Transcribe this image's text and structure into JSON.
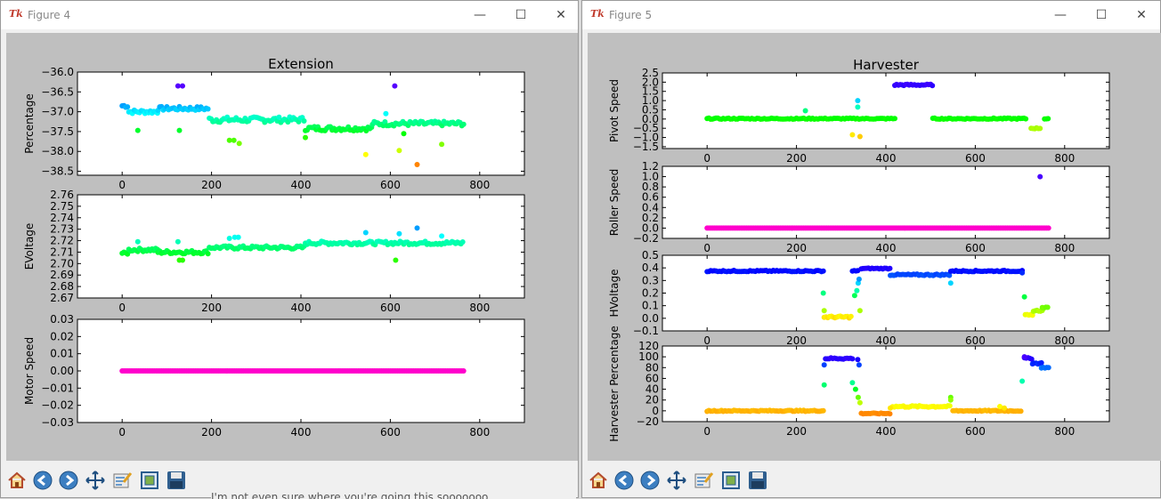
{
  "windows": [
    {
      "title": "Figure 4"
    },
    {
      "title": "Figure 5"
    }
  ],
  "toolbar_icons": [
    "home-icon",
    "back-icon",
    "forward-icon",
    "pan-icon",
    "configure-subplots-icon",
    "edit-icon",
    "save-icon"
  ],
  "background_text": "I'm not even sure where you're going this sooooooo",
  "chart_data": [
    {
      "window": "Figure 4",
      "panel": 0,
      "type": "scatter",
      "title": "Extension",
      "ylabel": "Percentage",
      "xlim": [
        -100,
        900
      ],
      "ylim": [
        -38.6,
        -36.0
      ],
      "xticks": [
        "0",
        "200",
        "400",
        "600",
        "800"
      ],
      "yticks": [
        "−36.0",
        "−36.5",
        "−37.0",
        "−37.5",
        "−38.0",
        "−38.5"
      ],
      "segments": [
        {
          "from": 0,
          "to": 15,
          "y": -36.85,
          "j": 0.05
        },
        {
          "from": 15,
          "to": 80,
          "y": -37.0,
          "j": 0.05
        },
        {
          "from": 80,
          "to": 195,
          "y": -36.92,
          "j": 0.05
        },
        {
          "from": 195,
          "to": 410,
          "y": -37.2,
          "j": 0.07
        },
        {
          "from": 410,
          "to": 560,
          "y": -37.42,
          "j": 0.06
        },
        {
          "from": 560,
          "to": 765,
          "y": -37.3,
          "j": 0.06
        }
      ],
      "outliers": [
        [
          35,
          -37.47
        ],
        [
          125,
          -36.35
        ],
        [
          135,
          -36.35
        ],
        [
          128,
          -37.47
        ],
        [
          240,
          -37.72
        ],
        [
          250,
          -37.72
        ],
        [
          262,
          -37.8
        ],
        [
          410,
          -37.65
        ],
        [
          545,
          -38.08
        ],
        [
          590,
          -37.05
        ],
        [
          610,
          -36.35
        ],
        [
          620,
          -37.98
        ],
        [
          630,
          -37.55
        ],
        [
          660,
          -38.33
        ],
        [
          715,
          -37.82
        ]
      ]
    },
    {
      "window": "Figure 4",
      "panel": 1,
      "type": "scatter",
      "title": "",
      "ylabel": "EVoltage",
      "xlim": [
        -100,
        900
      ],
      "ylim": [
        2.67,
        2.76
      ],
      "xticks": [
        "0",
        "200",
        "400",
        "600",
        "800"
      ],
      "yticks": [
        "2.76",
        "2.75",
        "2.74",
        "2.73",
        "2.72",
        "2.71",
        "2.70",
        "2.69",
        "2.68",
        "2.67"
      ],
      "segments": [
        {
          "from": 0,
          "to": 15,
          "y": 2.709,
          "j": 0.001
        },
        {
          "from": 15,
          "to": 80,
          "y": 2.712,
          "j": 0.0015
        },
        {
          "from": 80,
          "to": 195,
          "y": 2.71,
          "j": 0.0015
        },
        {
          "from": 195,
          "to": 410,
          "y": 2.714,
          "j": 0.0015
        },
        {
          "from": 410,
          "to": 765,
          "y": 2.718,
          "j": 0.0015
        }
      ],
      "outliers": [
        [
          35,
          2.719
        ],
        [
          125,
          2.719
        ],
        [
          128,
          2.703
        ],
        [
          135,
          2.703
        ],
        [
          240,
          2.722
        ],
        [
          252,
          2.723
        ],
        [
          260,
          2.723
        ],
        [
          545,
          2.727
        ],
        [
          612,
          2.703
        ],
        [
          620,
          2.726
        ],
        [
          660,
          2.731
        ],
        [
          715,
          2.724
        ]
      ]
    },
    {
      "window": "Figure 4",
      "panel": 2,
      "type": "scatter",
      "title": "",
      "ylabel": "Motor Speed",
      "xlim": [
        -100,
        900
      ],
      "ylim": [
        -0.03,
        0.03
      ],
      "xticks": [
        "0",
        "200",
        "400",
        "600",
        "800"
      ],
      "yticks": [
        "0.03",
        "0.02",
        "0.01",
        "0.00",
        "−0.01",
        "−0.02",
        "−0.03"
      ],
      "segments": [
        {
          "from": 0,
          "to": 765,
          "y": 0.0,
          "j": 0
        }
      ],
      "outliers": []
    },
    {
      "window": "Figure 5",
      "panel": 0,
      "type": "scatter",
      "title": "Harvester",
      "ylabel": "Pivot Speed",
      "xlim": [
        -100,
        900
      ],
      "ylim": [
        -1.6,
        2.5
      ],
      "xticks": [
        "0",
        "200",
        "400",
        "600",
        "800"
      ],
      "yticks": [
        "2.5",
        "2.0",
        "1.5",
        "1.0",
        "0.5",
        "0.0",
        "−0.5",
        "−1.0",
        "−1.5"
      ],
      "segments": [
        {
          "from": 0,
          "to": 420,
          "y": 0.02,
          "j": 0.03
        },
        {
          "from": 420,
          "to": 505,
          "y": 1.85,
          "j": 0.04
        },
        {
          "from": 505,
          "to": 715,
          "y": 0.02,
          "j": 0.03
        },
        {
          "from": 725,
          "to": 745,
          "y": -0.5,
          "j": 0.03
        },
        {
          "from": 755,
          "to": 765,
          "y": 0.02,
          "j": 0.02
        }
      ],
      "outliers": [
        [
          220,
          0.45
        ],
        [
          325,
          -0.85
        ],
        [
          337,
          1.0
        ],
        [
          337,
          0.65
        ],
        [
          342,
          -0.95
        ]
      ]
    },
    {
      "window": "Figure 5",
      "panel": 1,
      "type": "scatter",
      "title": "",
      "ylabel": "Roller Speed",
      "xlim": [
        -100,
        900
      ],
      "ylim": [
        -0.2,
        1.2
      ],
      "xticks": [
        "0",
        "200",
        "400",
        "600",
        "800"
      ],
      "yticks": [
        "1.2",
        "1.0",
        "0.8",
        "0.6",
        "0.4",
        "0.2",
        "0.0",
        "−0.2"
      ],
      "segments": [
        {
          "from": 0,
          "to": 765,
          "y": 0.0,
          "j": 0
        }
      ],
      "outliers": [
        [
          745,
          1.0
        ]
      ]
    },
    {
      "window": "Figure 5",
      "panel": 2,
      "type": "scatter",
      "title": "",
      "ylabel": "HVoltage",
      "xlim": [
        -100,
        900
      ],
      "ylim": [
        -0.1,
        0.5
      ],
      "xticks": [
        "0",
        "200",
        "400",
        "600",
        "800"
      ],
      "yticks": [
        "0.5",
        "0.4",
        "0.3",
        "0.2",
        "0.1",
        "0.0",
        "−0.1"
      ],
      "segments": [
        {
          "from": 0,
          "to": 260,
          "y": 0.375,
          "j": 0.005
        },
        {
          "from": 262,
          "to": 325,
          "y": 0.01,
          "j": 0.008
        },
        {
          "from": 325,
          "to": 340,
          "y": 0.375,
          "j": 0.005
        },
        {
          "from": 345,
          "to": 410,
          "y": 0.395,
          "j": 0.004
        },
        {
          "from": 410,
          "to": 545,
          "y": 0.345,
          "j": 0.006
        },
        {
          "from": 545,
          "to": 705,
          "y": 0.375,
          "j": 0.005
        },
        {
          "from": 712,
          "to": 730,
          "y": 0.02,
          "j": 0.01
        },
        {
          "from": 730,
          "to": 750,
          "y": 0.06,
          "j": 0.005
        },
        {
          "from": 750,
          "to": 765,
          "y": 0.085,
          "j": 0.003
        }
      ],
      "outliers": [
        [
          260,
          0.2
        ],
        [
          262,
          0.06
        ],
        [
          330,
          0.18
        ],
        [
          335,
          0.22
        ],
        [
          338,
          0.28
        ],
        [
          340,
          0.31
        ],
        [
          342,
          0.06
        ],
        [
          545,
          0.28
        ],
        [
          710,
          0.17
        ],
        [
          705,
          0.36
        ]
      ]
    },
    {
      "window": "Figure 5",
      "panel": 3,
      "type": "scatter",
      "title": "",
      "ylabel": "Harvester Percentage",
      "xlim": [
        -100,
        900
      ],
      "ylim": [
        -20,
        120
      ],
      "xticks": [
        "0",
        "200",
        "400",
        "600",
        "800"
      ],
      "yticks": [
        "120",
        "100",
        "80",
        "60",
        "40",
        "20",
        "0",
        "−20"
      ],
      "segments": [
        {
          "from": 0,
          "to": 260,
          "y": 0,
          "j": 1
        },
        {
          "from": 265,
          "to": 325,
          "y": 97,
          "j": 1.5
        },
        {
          "from": 345,
          "to": 410,
          "y": -5,
          "j": 0.8
        },
        {
          "from": 415,
          "to": 545,
          "y": 8,
          "j": 1.5
        },
        {
          "from": 550,
          "to": 705,
          "y": 0,
          "j": 1
        },
        {
          "from": 710,
          "to": 728,
          "y": 97,
          "j": 1.5
        },
        {
          "from": 728,
          "to": 748,
          "y": 88,
          "j": 1.5
        },
        {
          "from": 748,
          "to": 765,
          "y": 80,
          "j": 1
        }
      ],
      "outliers": [
        [
          262,
          85
        ],
        [
          262,
          48
        ],
        [
          325,
          52
        ],
        [
          332,
          40
        ],
        [
          337,
          95
        ],
        [
          340,
          85
        ],
        [
          338,
          25
        ],
        [
          342,
          15
        ],
        [
          410,
          5
        ],
        [
          545,
          25
        ],
        [
          545,
          20
        ],
        [
          655,
          8
        ],
        [
          665,
          5
        ],
        [
          705,
          55
        ],
        [
          710,
          100
        ]
      ]
    }
  ]
}
